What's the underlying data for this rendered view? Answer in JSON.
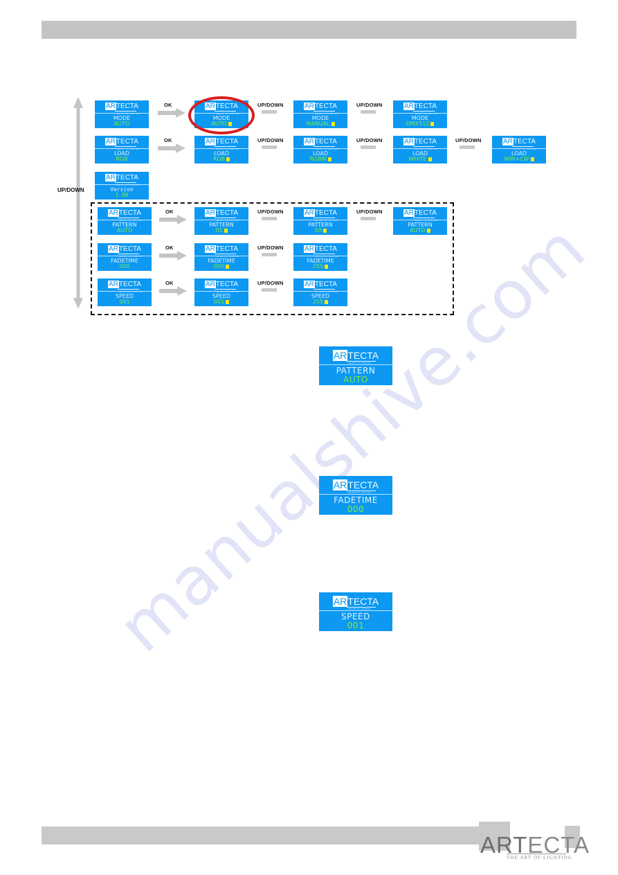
{
  "brand": {
    "lcd_logo_ar": "AR",
    "lcd_logo_rest": "TECTA",
    "lcd_logo_tagline": "THE ART OF LIGHTING",
    "footer_logo_bold": "ART",
    "footer_logo_rest": "ECTA",
    "footer_tagline": "THE ART OF LIGHTING"
  },
  "watermark": {
    "text": "manualshive.com"
  },
  "colors": {
    "lcd_background": "#0d98f2",
    "lcd_label_text": "#dff3ff",
    "lcd_value_text": "#7cf03a",
    "cursor_block": "#ffe900",
    "highlight_ellipse": "#d81f1f",
    "arrow_gray": "#c9c9c9",
    "bar_gray": "#c4c4c4"
  },
  "side_nav": {
    "updown_label": "UP/DOWN"
  },
  "connectors": {
    "ok_label": "OK",
    "updown_label": "UP/DOWN"
  },
  "menu_flow": {
    "rows": [
      {
        "name": "mode",
        "screens": [
          {
            "label": "MODE",
            "value": "AUTO",
            "cursor": false,
            "highlighted": false
          },
          {
            "label": "MODE",
            "value": "AUTO",
            "cursor": true,
            "highlighted": true
          },
          {
            "label": "MODE",
            "value": "MANUAL",
            "cursor": true,
            "highlighted": false
          },
          {
            "label": "MODE",
            "value": "DMX512",
            "cursor": true,
            "highlighted": false
          }
        ],
        "connectors": [
          "OK",
          "UP/DOWN",
          "UP/DOWN"
        ]
      },
      {
        "name": "load",
        "screens": [
          {
            "label": "LOAD",
            "value": "RGB",
            "cursor": false,
            "highlighted": false
          },
          {
            "label": "LOAD",
            "value": "RGB",
            "cursor": true,
            "highlighted": false
          },
          {
            "label": "LOAD",
            "value": "RGBW",
            "cursor": true,
            "highlighted": false
          },
          {
            "label": "LOAD",
            "value": "WHITE",
            "cursor": true,
            "highlighted": false
          },
          {
            "label": "LOAD",
            "value": "WW+CW",
            "cursor": true,
            "highlighted": false
          }
        ],
        "connectors": [
          "OK",
          "UP/DOWN",
          "UP/DOWN",
          "UP/DOWN"
        ]
      },
      {
        "name": "version",
        "screens": [
          {
            "label": "Version",
            "value": "1.00",
            "cursor": false,
            "highlighted": false
          }
        ],
        "connectors": []
      },
      {
        "name": "pattern",
        "screens": [
          {
            "label": "PATTERN",
            "value": "AUTO",
            "cursor": false,
            "highlighted": false
          },
          {
            "label": "PATTERN",
            "value": "01",
            "cursor": true,
            "highlighted": false
          },
          {
            "label": "PATTERN",
            "value": "10",
            "cursor": true,
            "highlighted": false
          },
          {
            "label": "PATTERN",
            "value": "AUTO",
            "cursor": true,
            "highlighted": false
          }
        ],
        "connectors": [
          "OK",
          "UP/DOWN",
          "UP/DOWN"
        ]
      },
      {
        "name": "fadetime",
        "screens": [
          {
            "label": "FADETIME",
            "value": "000",
            "cursor": false,
            "highlighted": false
          },
          {
            "label": "FADETIME",
            "value": "000",
            "cursor": true,
            "highlighted": false
          },
          {
            "label": "FADETIME",
            "value": "255",
            "cursor": true,
            "highlighted": false
          }
        ],
        "connectors": [
          "OK",
          "UP/DOWN"
        ]
      },
      {
        "name": "speed",
        "screens": [
          {
            "label": "SPEED",
            "value": "001",
            "cursor": false,
            "highlighted": false
          },
          {
            "label": "SPEED",
            "value": "001",
            "cursor": true,
            "highlighted": false
          },
          {
            "label": "SPEED",
            "value": "255",
            "cursor": true,
            "highlighted": false
          }
        ],
        "connectors": [
          "OK",
          "UP/DOWN"
        ]
      }
    ]
  },
  "detail_screens": [
    {
      "name": "pattern-detail",
      "label": "PATTERN",
      "value": "AUTO"
    },
    {
      "name": "fadetime-detail",
      "label": "FADETIME",
      "value": "000"
    },
    {
      "name": "speed-detail",
      "label": "SPEED",
      "value": "001"
    }
  ]
}
